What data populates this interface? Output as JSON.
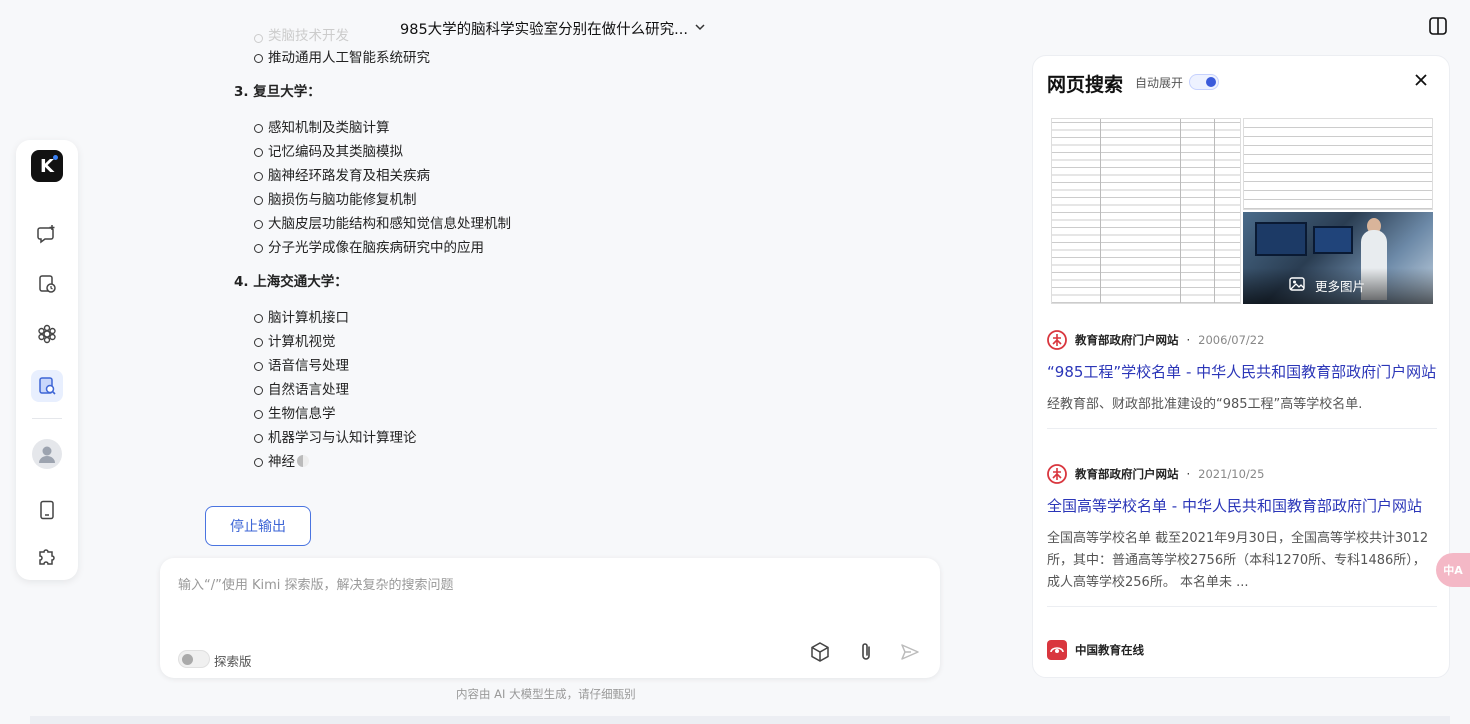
{
  "header": {
    "conversation_title": "985大学的脑科学实验室分别在做什么研究...",
    "dropdown_icon": "chevron-down-icon",
    "panel_toggle_icon": "sidebar-toggle-icon"
  },
  "sidebar": {
    "logo_letter": "K",
    "items": [
      {
        "icon": "new-chat-icon"
      },
      {
        "icon": "history-icon"
      },
      {
        "icon": "explore-icon"
      },
      {
        "icon": "search-doc-icon",
        "active": true
      },
      {
        "icon": "user-avatar-icon"
      },
      {
        "icon": "mobile-icon"
      },
      {
        "icon": "plugin-icon"
      }
    ]
  },
  "content": {
    "faded_item": "类脑技术开发",
    "pre_items": [
      "推动通用人工智能系统研究"
    ],
    "sections": [
      {
        "heading": "3. 复旦大学：",
        "items": [
          "感知机制及类脑计算",
          "记忆编码及其类脑模拟",
          "脑神经环路发育及相关疾病",
          "脑损伤与脑功能修复机制",
          "大脑皮层功能结构和感知觉信息处理机制",
          "分子光学成像在脑疾病研究中的应用"
        ]
      },
      {
        "heading": "4. 上海交通大学：",
        "items": [
          "脑计算机接口",
          "计算机视觉",
          "语音信号处理",
          "自然语言处理",
          "生物信息学",
          "机器学习与认知计算理论",
          "神经"
        ]
      }
    ]
  },
  "stop_button": {
    "label": "停止输出"
  },
  "input": {
    "placeholder": "输入“/”使用 Kimi 探索版，解决复杂的搜索问题",
    "mode_label": "探索版",
    "tools": [
      "cube-icon",
      "paperclip-icon",
      "send-icon"
    ]
  },
  "disclaimer": "内容由 AI 大模型生成，请仔细甄别",
  "search_panel": {
    "title": "网页搜索",
    "auto_expand_label": "自动展开",
    "auto_expand_on": true,
    "more_images_label": "更多图片",
    "results": [
      {
        "source": "教育部政府门户网站",
        "date": "2006/07/22",
        "title": "“985工程”学校名单 - 中华人民共和国教育部政府门户网站",
        "snippet": "经教育部、财政部批准建设的“985工程”高等学校名单."
      },
      {
        "source": "教育部政府门户网站",
        "date": "2021/10/25",
        "title": "全国高等学校名单 - 中华人民共和国教育部政府门户网站",
        "snippet": "全国高等学校名单 截至2021年9月30日，全国高等学校共计3012所，其中：普通高等学校2756所（本科1270所、专科1486所），成人高等学校256所。 本名单未 ..."
      },
      {
        "source": "中国教育在线",
        "date": "",
        "title": "",
        "snippet": ""
      }
    ]
  },
  "translate_badge": "中A",
  "colors": {
    "accent": "#3e66d6",
    "link": "#2b36b8",
    "moe_logo": "#d9363e"
  }
}
